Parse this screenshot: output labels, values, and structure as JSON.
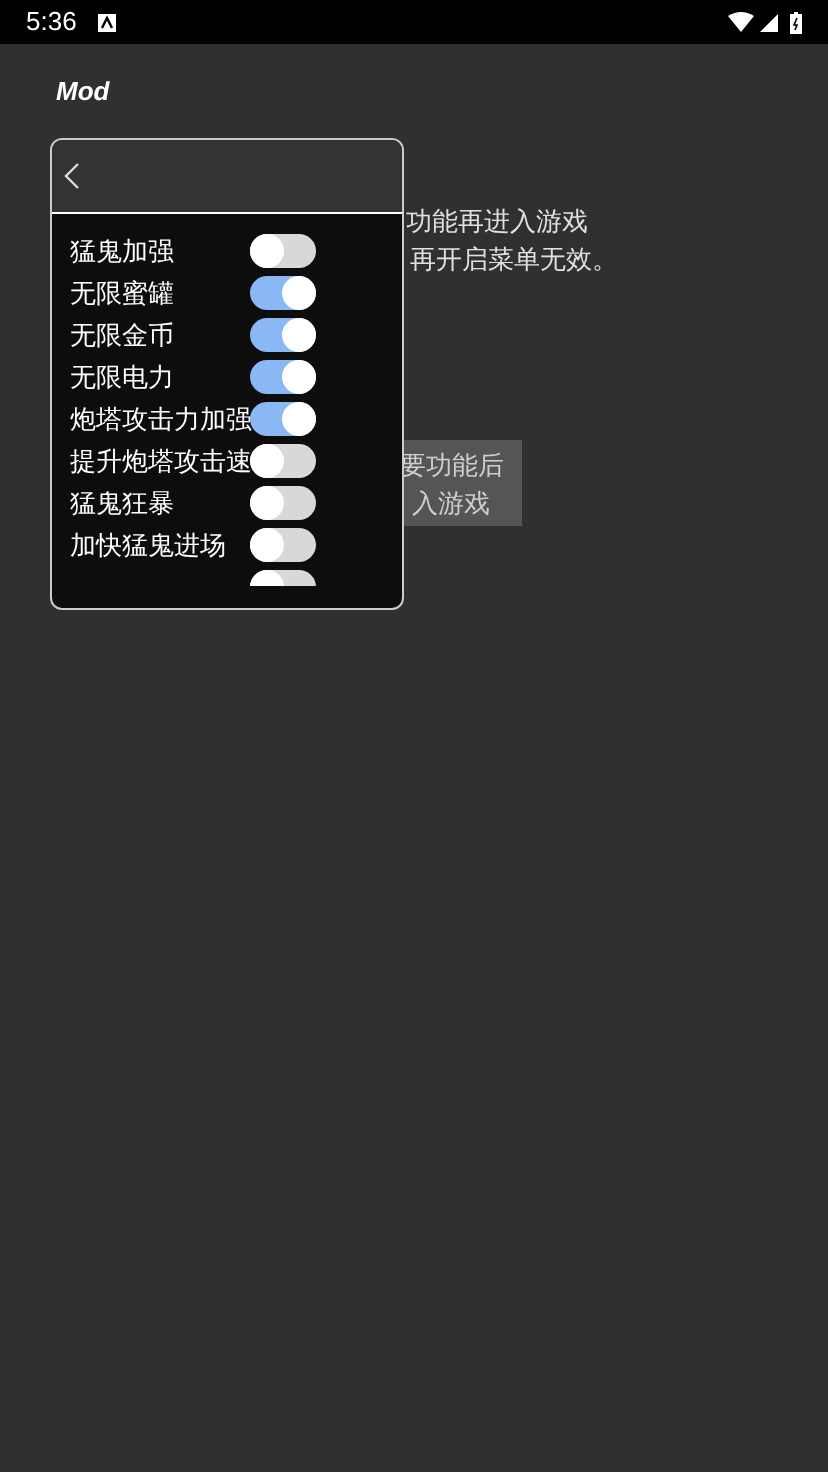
{
  "status_bar": {
    "time": "5:36"
  },
  "app_bar": {
    "title": "Mod"
  },
  "notice": {
    "lines": [
      "功能再进入游戏",
      "再开启菜单无效。"
    ]
  },
  "toast": {
    "lines": [
      "要功能后",
      "入游戏"
    ]
  },
  "menu": {
    "items": [
      {
        "label": "猛鬼加强",
        "on": false
      },
      {
        "label": "无限蜜罐",
        "on": true
      },
      {
        "label": "无限金币",
        "on": true
      },
      {
        "label": "无限电力",
        "on": true
      },
      {
        "label": "炮塔攻击力加强",
        "on": true
      },
      {
        "label": "提升炮塔攻击速",
        "on": false
      },
      {
        "label": "猛鬼狂暴",
        "on": false
      },
      {
        "label": "加快猛鬼进场",
        "on": false
      },
      {
        "on": false
      }
    ]
  }
}
